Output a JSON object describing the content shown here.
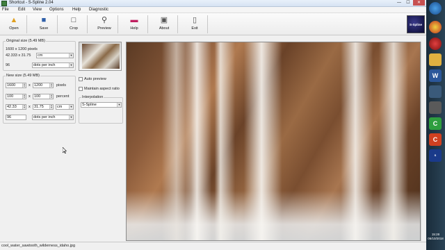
{
  "window": {
    "title": "Shortcut - S-Spline 2.04",
    "min_glyph": "—",
    "max_glyph": "☐",
    "close_glyph": "✕"
  },
  "menu": [
    "File",
    "Edit",
    "View",
    "Options",
    "Help",
    "Diagnostic"
  ],
  "toolbar": {
    "open": "Open",
    "save": "Save",
    "crop": "Crop",
    "preview": "Preview",
    "help": "Help",
    "about": "About",
    "exit": "Exit",
    "logo_text": "S-Spline"
  },
  "original": {
    "legend": "Original size (5.49 MB)",
    "pixels": "1600 x 1200 pixels",
    "dims": "42.333 x 31.75",
    "unit": "cm",
    "resolution": "96",
    "res_unit": "dots per inch"
  },
  "newsize": {
    "legend": "New size (5.49 MB)",
    "width_px": "1600",
    "height_px": "1200",
    "x1": "x",
    "px_unit": "pixels",
    "width_pct": "100",
    "height_pct": "100",
    "x2": "x",
    "pct_unit": "percent",
    "width_cm": "42.33",
    "height_cm": "31.75",
    "x3": "x",
    "cm_unit": "cm",
    "resolution": "96",
    "res_unit": "dots per inch"
  },
  "options": {
    "auto_preview": "Auto preview",
    "maintain_aspect": "Maintain aspect ratio",
    "interp_legend": "Interpolation",
    "interp_value": "S-Spline"
  },
  "status": {
    "filename": "cool_water_sawtooth_wilderness_idaho.jpg"
  },
  "taskbar": {
    "time": "15:28",
    "date": "06/10/2018"
  },
  "colors": {
    "accent": "#c75050",
    "panel": "#f0f0f0"
  }
}
